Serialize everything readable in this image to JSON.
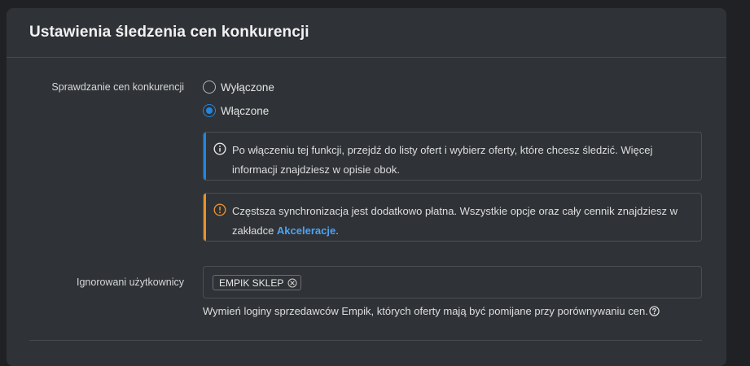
{
  "panel": {
    "title": "Ustawienia śledzenia cen konkurencji"
  },
  "competitor_check": {
    "label": "Sprawdzanie cen konkurencji",
    "options": [
      {
        "label": "Wyłączone",
        "selected": false
      },
      {
        "label": "Włączone",
        "selected": true
      }
    ]
  },
  "info_alert": {
    "icon": "info-icon",
    "color": "#1f86e0",
    "text": "Po włączeniu tej funkcji, przejdź do listy ofert i wybierz oferty, które chcesz śledzić. Więcej informacji znajdziesz w opisie obok."
  },
  "warning_alert": {
    "icon": "warning-icon",
    "color": "#e8912b",
    "text_before": "Częstsza synchronizacja jest dodatkowo płatna. Wszystkie opcje oraz cały cennik znajdziesz w zakładce ",
    "link": "Akceleracje",
    "text_after": "."
  },
  "ignored_users": {
    "label": "Ignorowani użytkownicy",
    "tags": [
      "EMPIK SKLEP"
    ],
    "helper": "Wymień loginy sprzedawców Empik, których oferty mają być pomijane przy porównywaniu cen.",
    "help_icon": "question-circle-icon"
  }
}
